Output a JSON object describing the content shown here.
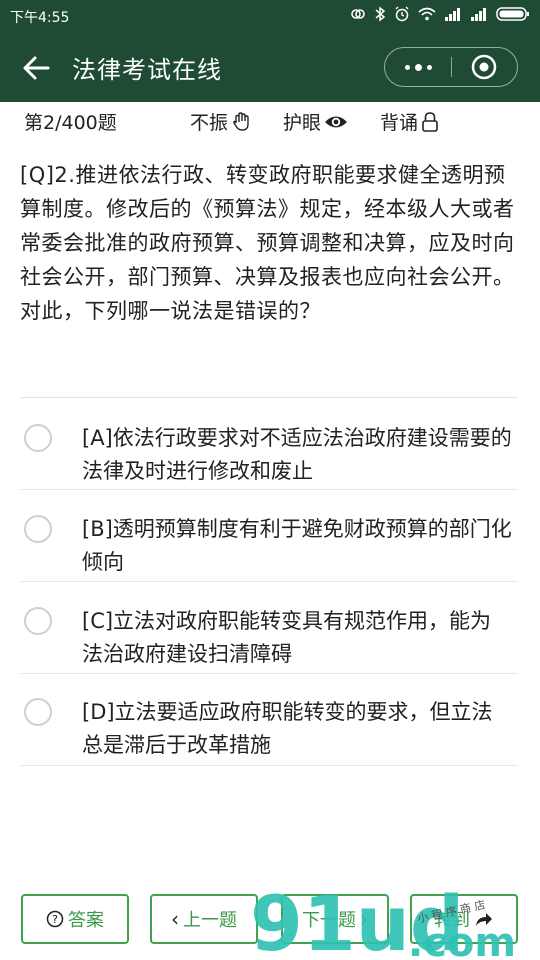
{
  "status_bar": {
    "time": "下午4:55"
  },
  "header": {
    "title": "法律考试在线"
  },
  "info": {
    "counter": "第2/400题",
    "vibrate_label": "不振",
    "eye_label": "护眼",
    "recite_label": "背诵"
  },
  "question": {
    "text": "[Q]2.推进依法行政、转变政府职能要求健全透明预算制度。修改后的《预算法》规定，经本级人大或者常委会批准的政府预算、预算调整和决算，应及时向社会公开，部门预算、决算及报表也应向社会公开。对此，下列哪一说法是错误的？"
  },
  "options": [
    {
      "text": " [A]依法行政要求对不适应法治政府建设需要的法律及时进行修改和废止"
    },
    {
      "text": " [B]透明预算制度有利于避免财政预算的部门化倾向"
    },
    {
      "text": " [C]立法对政府职能转变具有规范作用，能为法治政府建设扫清障碍"
    },
    {
      "text": "[D]立法要适应政府职能转变的要求，但立法总是滞后于改革措施"
    }
  ],
  "bottom": {
    "answer_label": "答案",
    "prev_label": "上一题",
    "next_label": "下一题",
    "goto_label": "转到"
  },
  "watermark": {
    "brand": "91ud",
    "domain": ".com",
    "tagline": "小 程 序 商 店"
  },
  "colors": {
    "header_bg": "#1f4a34",
    "accent_green": "#3fa34d",
    "watermark_teal": "#2fc1b2"
  }
}
